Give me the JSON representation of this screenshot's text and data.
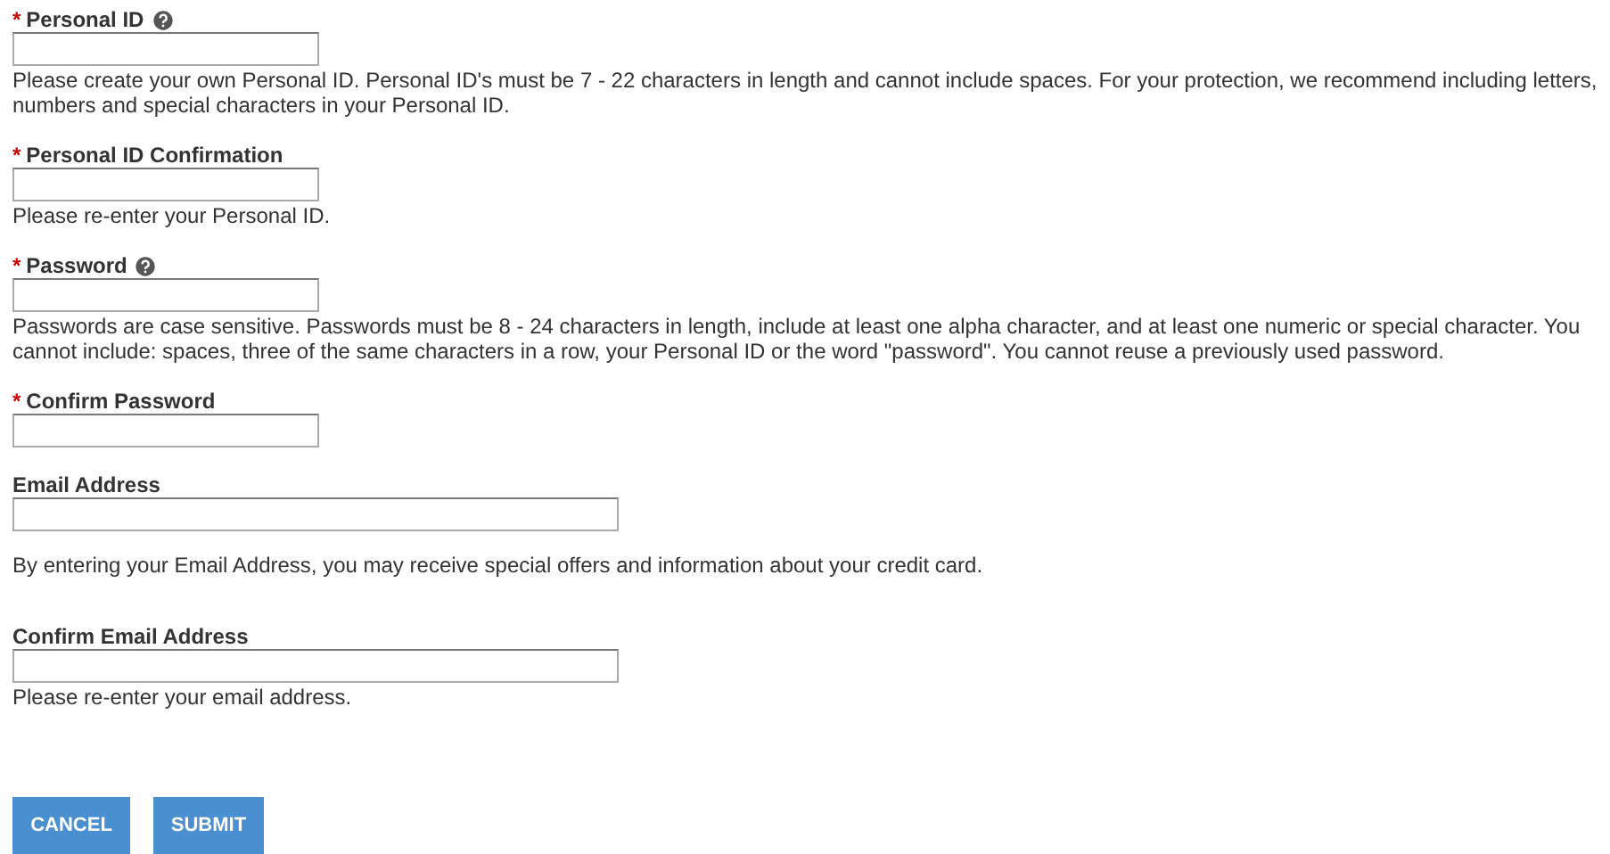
{
  "fields": [
    {
      "label": "Personal ID",
      "required_mark": "*",
      "help": true,
      "kind": "short",
      "hint": "Please create your own Personal ID.  Personal ID's must be 7 - 22 characters in length and cannot include spaces.  For your protection, we recommend including letters, numbers and special characters in your Personal ID."
    },
    {
      "label": "Personal ID Confirmation",
      "required_mark": "*",
      "help": false,
      "kind": "short",
      "hint": "Please re-enter your Personal ID."
    },
    {
      "label": "Password",
      "required_mark": "*",
      "help": true,
      "kind": "short",
      "hint": "Passwords are case sensitive. Passwords must be 8 - 24 characters in length, include at least one alpha character, and at least one numeric or special character.  You cannot include: spaces, three of the same characters in a row, your Personal ID or the word \"password\". You cannot reuse a previously used password."
    },
    {
      "label": "Confirm Password",
      "required_mark": "*",
      "help": false,
      "kind": "short"
    },
    {
      "label": "Email Address",
      "help": false,
      "kind": "long",
      "note": "By entering your Email Address, you may receive special offers and information about your credit card."
    },
    {
      "label": "Confirm Email Address",
      "help": false,
      "kind": "long",
      "hint": "Please re-enter your email address."
    }
  ],
  "buttons": [
    "CANCEL",
    "SUBMIT"
  ]
}
